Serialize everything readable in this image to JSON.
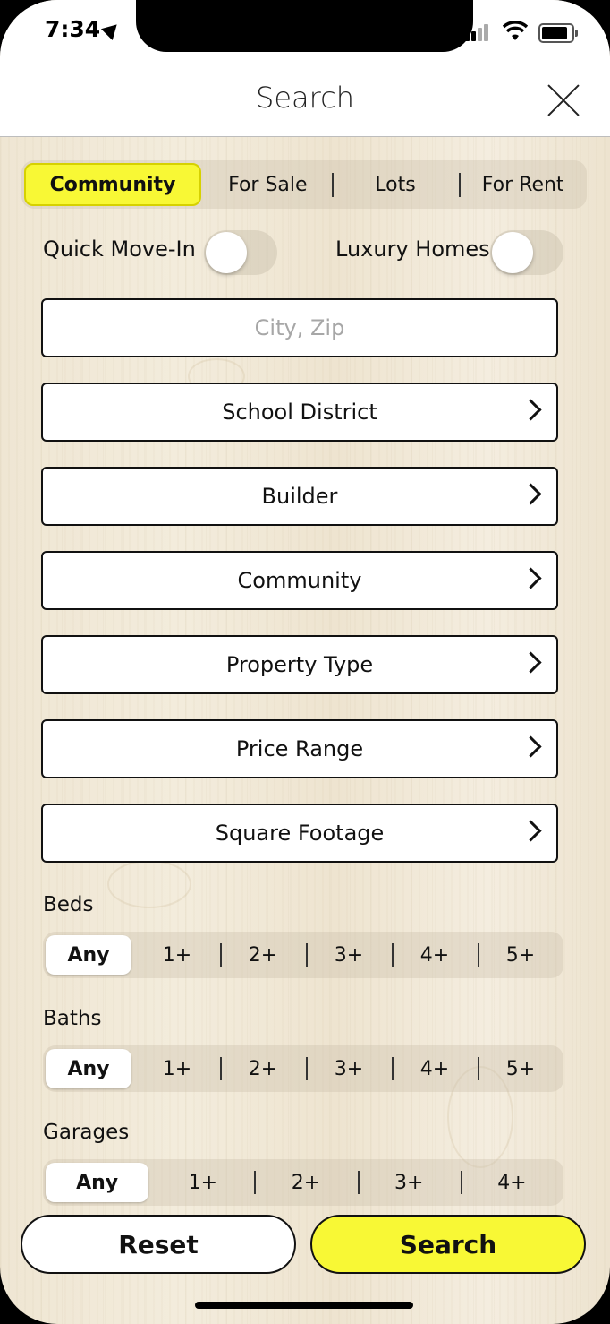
{
  "status_bar": {
    "time": "7:34"
  },
  "header": {
    "title": "Search"
  },
  "listing_types": [
    "Community",
    "For Sale",
    "Lots",
    "For Rent"
  ],
  "listing_type_selected": 0,
  "toggles": {
    "quick_move_in": {
      "label": "Quick Move-In",
      "on": false
    },
    "luxury_homes": {
      "label": "Luxury Homes",
      "on": false
    }
  },
  "search": {
    "placeholder": "City, Zip",
    "value": ""
  },
  "filters": [
    "School District",
    "Builder",
    "Community",
    "Property Type",
    "Price Range",
    "Square Footage"
  ],
  "beds": {
    "label": "Beds",
    "options": [
      "Any",
      "1+",
      "2+",
      "3+",
      "4+",
      "5+"
    ],
    "selected": 0
  },
  "baths": {
    "label": "Baths",
    "options": [
      "Any",
      "1+",
      "2+",
      "3+",
      "4+",
      "5+"
    ],
    "selected": 0
  },
  "garages": {
    "label": "Garages",
    "options": [
      "Any",
      "1+",
      "2+",
      "3+",
      "4+"
    ],
    "selected": 0
  },
  "actions": {
    "reset": "Reset",
    "search": "Search"
  },
  "colors": {
    "accent": "#f8f835",
    "background_wood": "#efe6d3"
  }
}
